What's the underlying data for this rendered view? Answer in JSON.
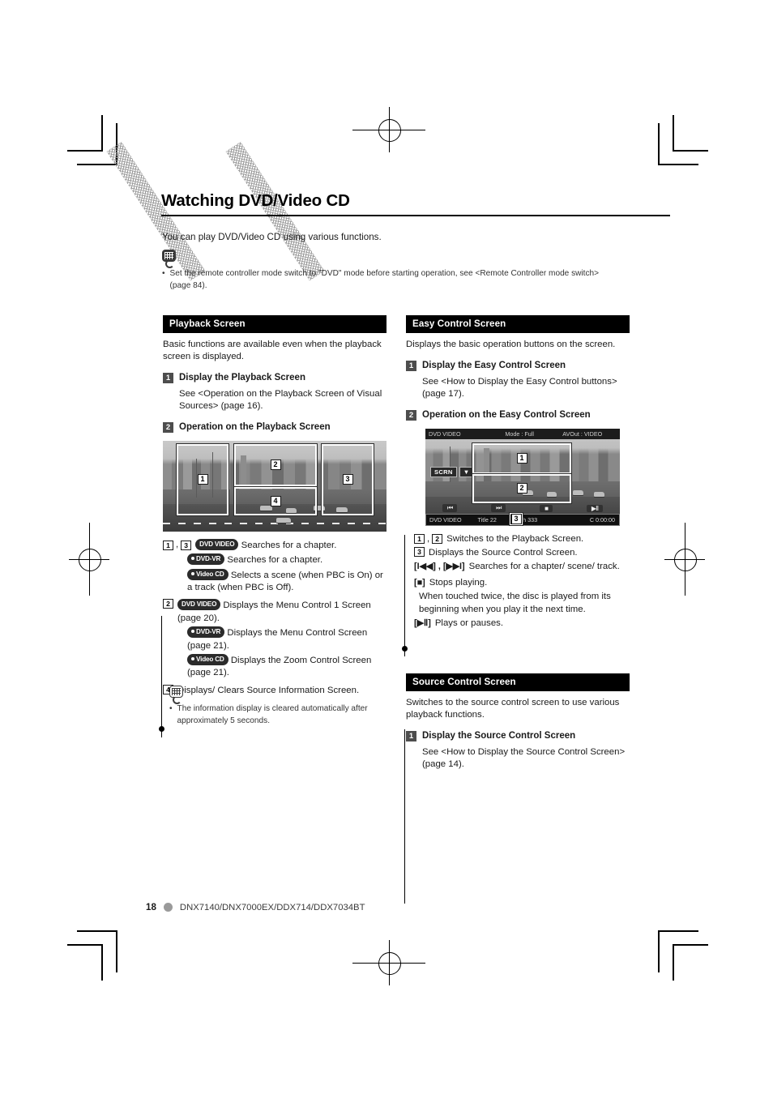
{
  "document": {
    "title": "Watching DVD/Video CD",
    "intro": "You can play DVD/Video CD using various functions.",
    "top_note": {
      "icon": "note-bubble-icon",
      "bullet": "•",
      "line1": "Set the remote controller mode switch to \"DVD\" mode before starting operation, see <Remote Controller mode switch>",
      "line2": "(page 84)."
    },
    "footer": {
      "page_number": "18",
      "models": "DNX7140/DNX7000EX/DDX714/DDX7034BT"
    }
  },
  "playback_section": {
    "heading": "Playback Screen",
    "description": "Basic functions are available even when the playback screen is displayed.",
    "steps": [
      {
        "num": "1",
        "title": "Display the Playback Screen",
        "body": "See <Operation on the Playback Screen of Visual Sources> (page 16)."
      },
      {
        "num": "2",
        "title": "Operation on the Playback Screen",
        "body": ""
      }
    ],
    "figure": {
      "name": "playback-screen-figure",
      "hotspots": [
        "1",
        "2",
        "3",
        "4"
      ]
    },
    "legend": [
      {
        "keys": [
          "1",
          "3"
        ],
        "rows": [
          {
            "badge": "DVD VIDEO",
            "badge_style": "plain",
            "text": "Searches for a chapter."
          },
          {
            "badge": "DVD-VR",
            "badge_style": "dot",
            "text": "Searches for a chapter."
          },
          {
            "badge": "Video CD",
            "badge_style": "dot",
            "text": "Selects a scene (when PBC is On) or a track (when PBC is Off)."
          }
        ]
      },
      {
        "keys": [
          "2"
        ],
        "rows": [
          {
            "badge": "DVD VIDEO",
            "badge_style": "plain",
            "text": "Displays the Menu Control 1 Screen (page 20)."
          },
          {
            "badge": "DVD-VR",
            "badge_style": "dot",
            "text": "Displays the Menu Control Screen (page 21)."
          },
          {
            "badge": "Video CD",
            "badge_style": "dot",
            "text": "Displays the Zoom Control Screen (page 21)."
          }
        ]
      },
      {
        "keys": [
          "4"
        ],
        "rows": [
          {
            "badge": "",
            "badge_style": "none",
            "text": "Displays/ Clears Source Information Screen."
          }
        ]
      }
    ],
    "note": {
      "icon": "note-bubble-outline-icon",
      "bullet": "•",
      "line1": "The information display is cleared automatically after",
      "line2": "approximately 5 seconds."
    }
  },
  "easy_control_section": {
    "heading": "Easy Control Screen",
    "description": "Displays the basic operation buttons on the screen.",
    "steps": [
      {
        "num": "1",
        "title": "Display the Easy Control Screen",
        "body": "See <How to Display the Easy Control buttons> (page 17)."
      },
      {
        "num": "2",
        "title": "Operation on the Easy Control Screen",
        "body": ""
      }
    ],
    "screen": {
      "name": "easy-control-screen-figure",
      "status_top": {
        "source": "DVD VIDEO",
        "mode": "Mode : Full",
        "avout": "AVOut : VIDEO"
      },
      "scrn_button": "SCRN",
      "scrn_dropdown": "▼",
      "transport_buttons": [
        "⏮",
        "⏭",
        "■",
        "▶Ⅱ"
      ],
      "status_bottom": {
        "source": "DVD VIDEO",
        "title": "Title 22",
        "chapter": "Ch 333",
        "time": "C  0:00:00"
      },
      "hotspots": [
        "1",
        "2",
        "3"
      ]
    },
    "legend": [
      {
        "keys": [
          "1",
          "2"
        ],
        "text": "Switches to the Playback Screen."
      },
      {
        "keys": [
          "3"
        ],
        "text": "Displays the Source Control Screen."
      },
      {
        "keys": [
          "[I◀◀]",
          "[▶▶I]"
        ],
        "text": "Searches for a chapter/ scene/ track."
      },
      {
        "keys": [
          "[■]"
        ],
        "text": "Stops playing."
      },
      {
        "keys": [],
        "text": "When touched twice, the disc is played from its beginning when you play it the next time."
      },
      {
        "keys": [
          "[▶Ⅱ]"
        ],
        "text": "Plays or pauses."
      }
    ]
  },
  "source_control_section": {
    "heading": "Source Control Screen",
    "description": "Switches to the source control screen to use various playback functions.",
    "steps": [
      {
        "num": "1",
        "title": "Display the Source Control Screen",
        "body": "See <How to Display the Source Control Screen> (page 14)."
      }
    ]
  }
}
